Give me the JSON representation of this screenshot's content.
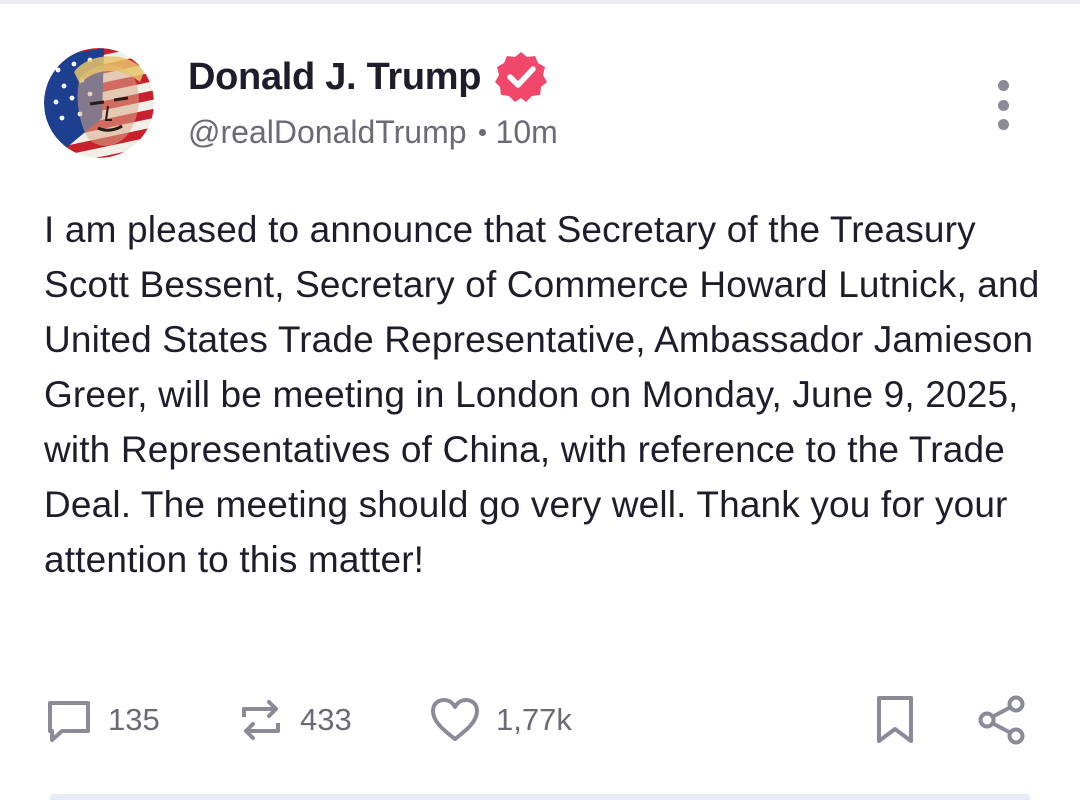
{
  "post": {
    "author": {
      "display_name": "Donald J. Trump",
      "handle": "@realDonaldTrump",
      "verified": true,
      "avatar": "avatar-flag-portrait"
    },
    "time_ago": "10m",
    "body": "I am pleased to announce that Secretary of the Treasury Scott Bessent, Secretary of Commerce Howard Lutnick, and United States Trade Representative, Ambassador Jamieson Greer, will be meeting in London on Monday, June 9, 2025, with Representatives of China, with reference to the Trade Deal. The meeting should go very well. Thank you for your attention to this matter!",
    "actions": {
      "replies": "135",
      "reposts": "433",
      "likes": "1,77k"
    },
    "icons": {
      "reply": "speech-bubble-icon",
      "repost": "repost-arrows-icon",
      "like": "heart-icon",
      "bookmark": "bookmark-icon",
      "share": "share-icon",
      "more": "more-vertical-icon",
      "verified": "verified-badge-icon"
    }
  },
  "colors": {
    "verified_badge": "#f0476a",
    "text_primary": "#1f1d2b",
    "text_secondary": "#6a6a78",
    "icon_gray": "#8a8a98"
  }
}
